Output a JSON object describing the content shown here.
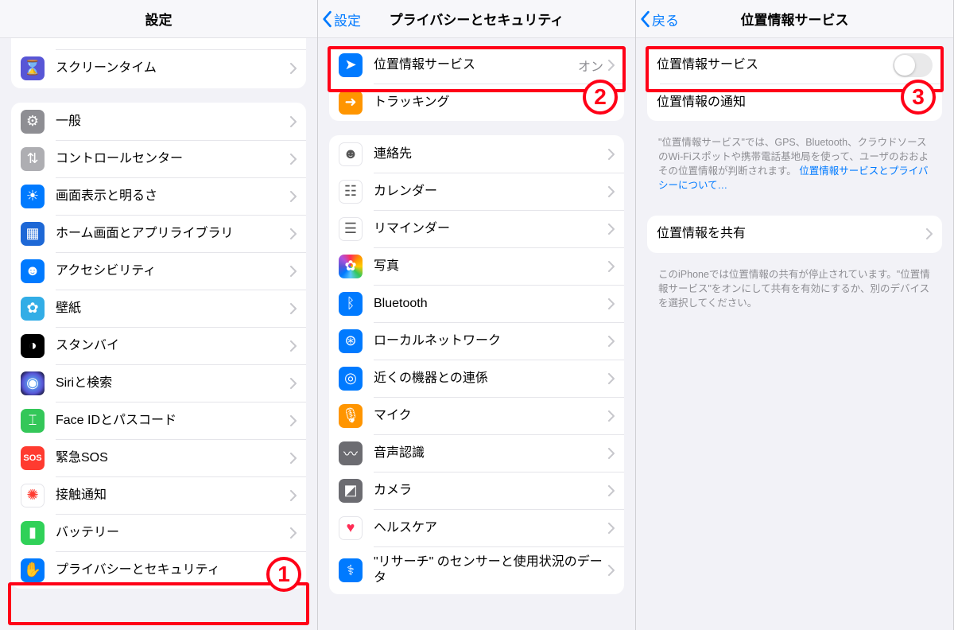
{
  "panel1": {
    "title": "設定",
    "top_partial": {
      "label": "スクリーンタイム",
      "icon": "hourglass",
      "color": "bg-purple"
    },
    "items": [
      {
        "label": "一般",
        "icon": "gear",
        "color": "bg-gray"
      },
      {
        "label": "コントロールセンター",
        "icon": "switches",
        "color": "bg-graylite"
      },
      {
        "label": "画面表示と明るさ",
        "icon": "brightness",
        "color": "bg-blue"
      },
      {
        "label": "ホーム画面とアプリライブラリ",
        "icon": "apps",
        "color": "bg-bluedk"
      },
      {
        "label": "アクセシビリティ",
        "icon": "accessibility",
        "color": "bg-blue"
      },
      {
        "label": "壁紙",
        "icon": "flower",
        "color": "bg-cyan"
      },
      {
        "label": "スタンバイ",
        "icon": "clock",
        "color": "bg-black"
      },
      {
        "label": "Siriと検索",
        "icon": "siri",
        "color": "bg-siri"
      },
      {
        "label": "Face IDとパスコード",
        "icon": "faceid",
        "color": "bg-green"
      },
      {
        "label": "緊急SOS",
        "icon": "sos",
        "color": "bg-red",
        "text_icon": "SOS"
      },
      {
        "label": "接触通知",
        "icon": "virus",
        "color": "bg-white",
        "glyph_color": "#ff3b30"
      },
      {
        "label": "バッテリー",
        "icon": "battery",
        "color": "bg-green2"
      },
      {
        "label": "プライバシーとセキュリティ",
        "icon": "hand",
        "color": "bg-blue"
      }
    ],
    "badge": "1"
  },
  "panel2": {
    "back": "設定",
    "title": "プライバシーとセキュリティ",
    "groupA": [
      {
        "label": "位置情報サービス",
        "detail": "オン",
        "icon": "location",
        "color": "bg-blue"
      },
      {
        "label": "トラッキング",
        "icon": "tracking",
        "color": "bg-orange"
      }
    ],
    "groupB": [
      {
        "label": "連絡先",
        "icon": "contacts",
        "color": "bg-white"
      },
      {
        "label": "カレンダー",
        "icon": "calendar",
        "color": "bg-white"
      },
      {
        "label": "リマインダー",
        "icon": "reminders",
        "color": "bg-white"
      },
      {
        "label": "写真",
        "icon": "photos",
        "color": "bg-multicol"
      },
      {
        "label": "Bluetooth",
        "icon": "bluetooth",
        "color": "bg-blue"
      },
      {
        "label": "ローカルネットワーク",
        "icon": "network",
        "color": "bg-blue"
      },
      {
        "label": "近くの機器との連係",
        "icon": "nearby",
        "color": "bg-blue"
      },
      {
        "label": "マイク",
        "icon": "mic",
        "color": "bg-orange"
      },
      {
        "label": "音声認識",
        "icon": "speech",
        "color": "bg-darkgray"
      },
      {
        "label": "カメラ",
        "icon": "camera",
        "color": "bg-darkgray"
      },
      {
        "label": "ヘルスケア",
        "icon": "health",
        "color": "bg-white",
        "glyph_color": "#ff2d55"
      },
      {
        "label": "\"リサーチ\" のセンサーと使用状況のデータ",
        "icon": "research",
        "color": "bg-blue"
      }
    ],
    "badge": "2"
  },
  "panel3": {
    "back": "戻る",
    "title": "位置情報サービス",
    "row_toggle": "位置情報サービス",
    "row_alerts": "位置情報の通知",
    "footnote_text": "\"位置情報サービス\"では、GPS、Bluetooth、クラウドソースのWi-Fiスポットや携帯電話基地局を使って、ユーザのおおよその位置情報が判断されます。",
    "footnote_link": "位置情報サービスとプライバシーについて…",
    "row_share": "位置情報を共有",
    "footnote2": "このiPhoneでは位置情報の共有が停止されています。\"位置情報サービス\"をオンにして共有を有効にするか、別のデバイスを選択してください。",
    "badge": "3"
  }
}
